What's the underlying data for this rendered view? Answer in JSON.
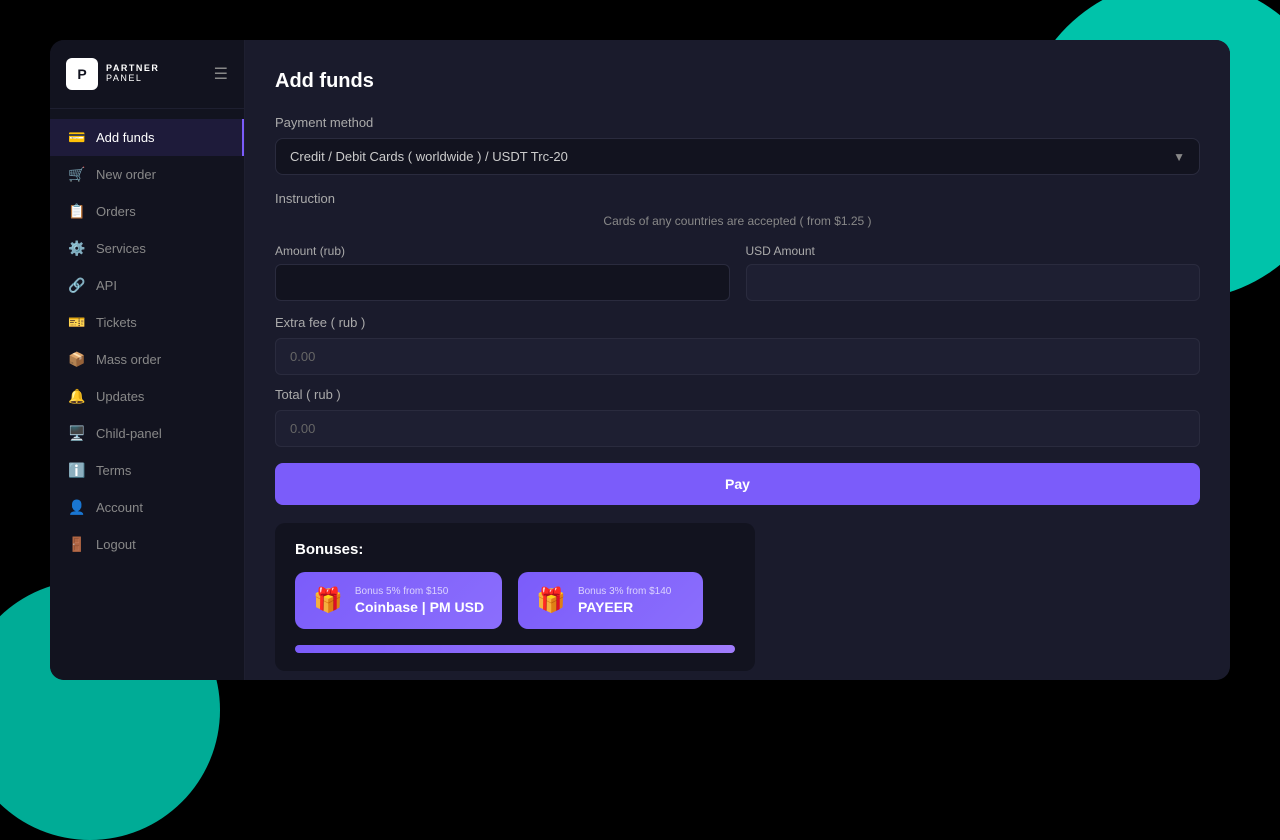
{
  "app": {
    "logo_letter": "P",
    "logo_partner": "PARTNER",
    "logo_panel": "PANEL"
  },
  "sidebar": {
    "items": [
      {
        "id": "add-funds",
        "label": "Add funds",
        "icon": "💳",
        "active": true
      },
      {
        "id": "new-order",
        "label": "New order",
        "icon": "🛒",
        "active": false
      },
      {
        "id": "orders",
        "label": "Orders",
        "icon": "📋",
        "active": false
      },
      {
        "id": "services",
        "label": "Services",
        "icon": "⚙️",
        "active": false
      },
      {
        "id": "api",
        "label": "API",
        "icon": "🔗",
        "active": false
      },
      {
        "id": "tickets",
        "label": "Tickets",
        "icon": "🎫",
        "active": false
      },
      {
        "id": "mass-order",
        "label": "Mass order",
        "icon": "📦",
        "active": false
      },
      {
        "id": "updates",
        "label": "Updates",
        "icon": "🔔",
        "active": false
      },
      {
        "id": "child-panel",
        "label": "Child-panel",
        "icon": "🖥️",
        "active": false
      },
      {
        "id": "terms",
        "label": "Terms",
        "icon": "ℹ️",
        "active": false
      },
      {
        "id": "account",
        "label": "Account",
        "icon": "👤",
        "active": false
      },
      {
        "id": "logout",
        "label": "Logout",
        "icon": "🚪",
        "active": false
      }
    ]
  },
  "page": {
    "title": "Add funds"
  },
  "payment_method": {
    "label": "Payment method",
    "selected": "Credit / Debit Cards ( worldwide ) / USDT Trc-20"
  },
  "instruction": {
    "label": "Instruction",
    "text": "Cards of any countries are accepted ( from $1.25 )"
  },
  "amount_rub": {
    "label": "Amount (rub)",
    "value": "",
    "placeholder": ""
  },
  "usd_amount": {
    "label": "USD Amount",
    "value": "",
    "placeholder": ""
  },
  "extra_fee": {
    "label": "Extra fee ( rub )",
    "value": "0.00"
  },
  "total": {
    "label": "Total ( rub )",
    "value": "0.00"
  },
  "pay_button": {
    "label": "Pay"
  },
  "bonuses": {
    "title": "Bonuses:",
    "cards": [
      {
        "id": "coinbase",
        "sub_text": "Bonus 5% from $150",
        "name": "Coinbase | PM USD"
      },
      {
        "id": "payeer",
        "sub_text": "Bonus 3% from $140",
        "name": "PAYEER"
      }
    ]
  }
}
